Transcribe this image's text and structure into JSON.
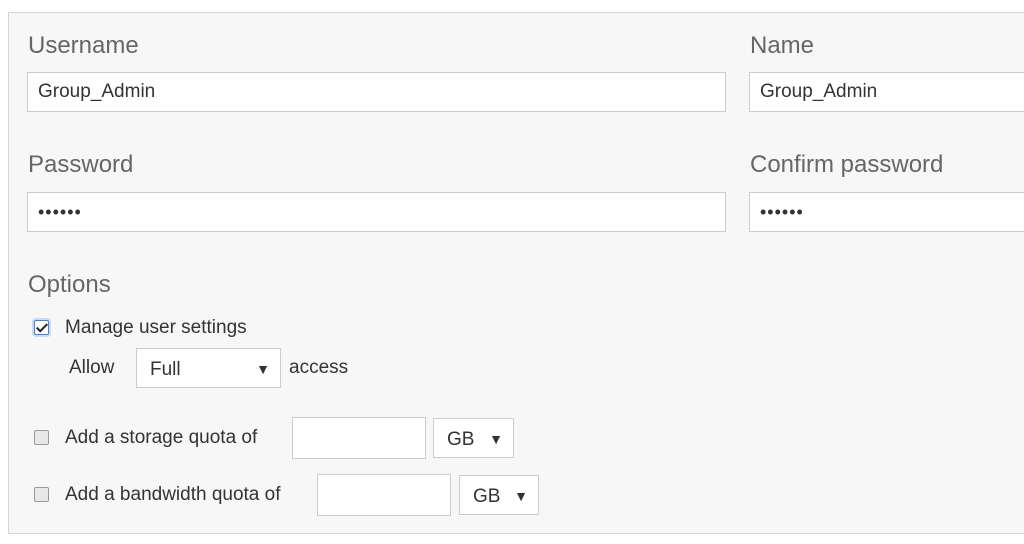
{
  "form": {
    "username": {
      "label": "Username",
      "value": "Group_Admin"
    },
    "name": {
      "label": "Name",
      "value": "Group_Admin"
    },
    "password": {
      "label": "Password",
      "value": "••••••"
    },
    "confirm_password": {
      "label": "Confirm password",
      "value": "••••••"
    }
  },
  "options": {
    "heading": "Options",
    "manage_user_settings": {
      "label": "Manage user settings",
      "checked": true
    },
    "allow_prefix": "Allow",
    "access_level": {
      "value": "Full",
      "options": [
        "Full"
      ]
    },
    "access_suffix": "access",
    "storage_quota": {
      "label": "Add a storage quota of",
      "checked": false,
      "value": "",
      "unit": "GB"
    },
    "bandwidth_quota": {
      "label": "Add a bandwidth quota of",
      "checked": false,
      "value": "",
      "unit": "GB"
    }
  },
  "icons": {
    "dropdown": "▼",
    "checkmark": "checkmark-icon"
  }
}
